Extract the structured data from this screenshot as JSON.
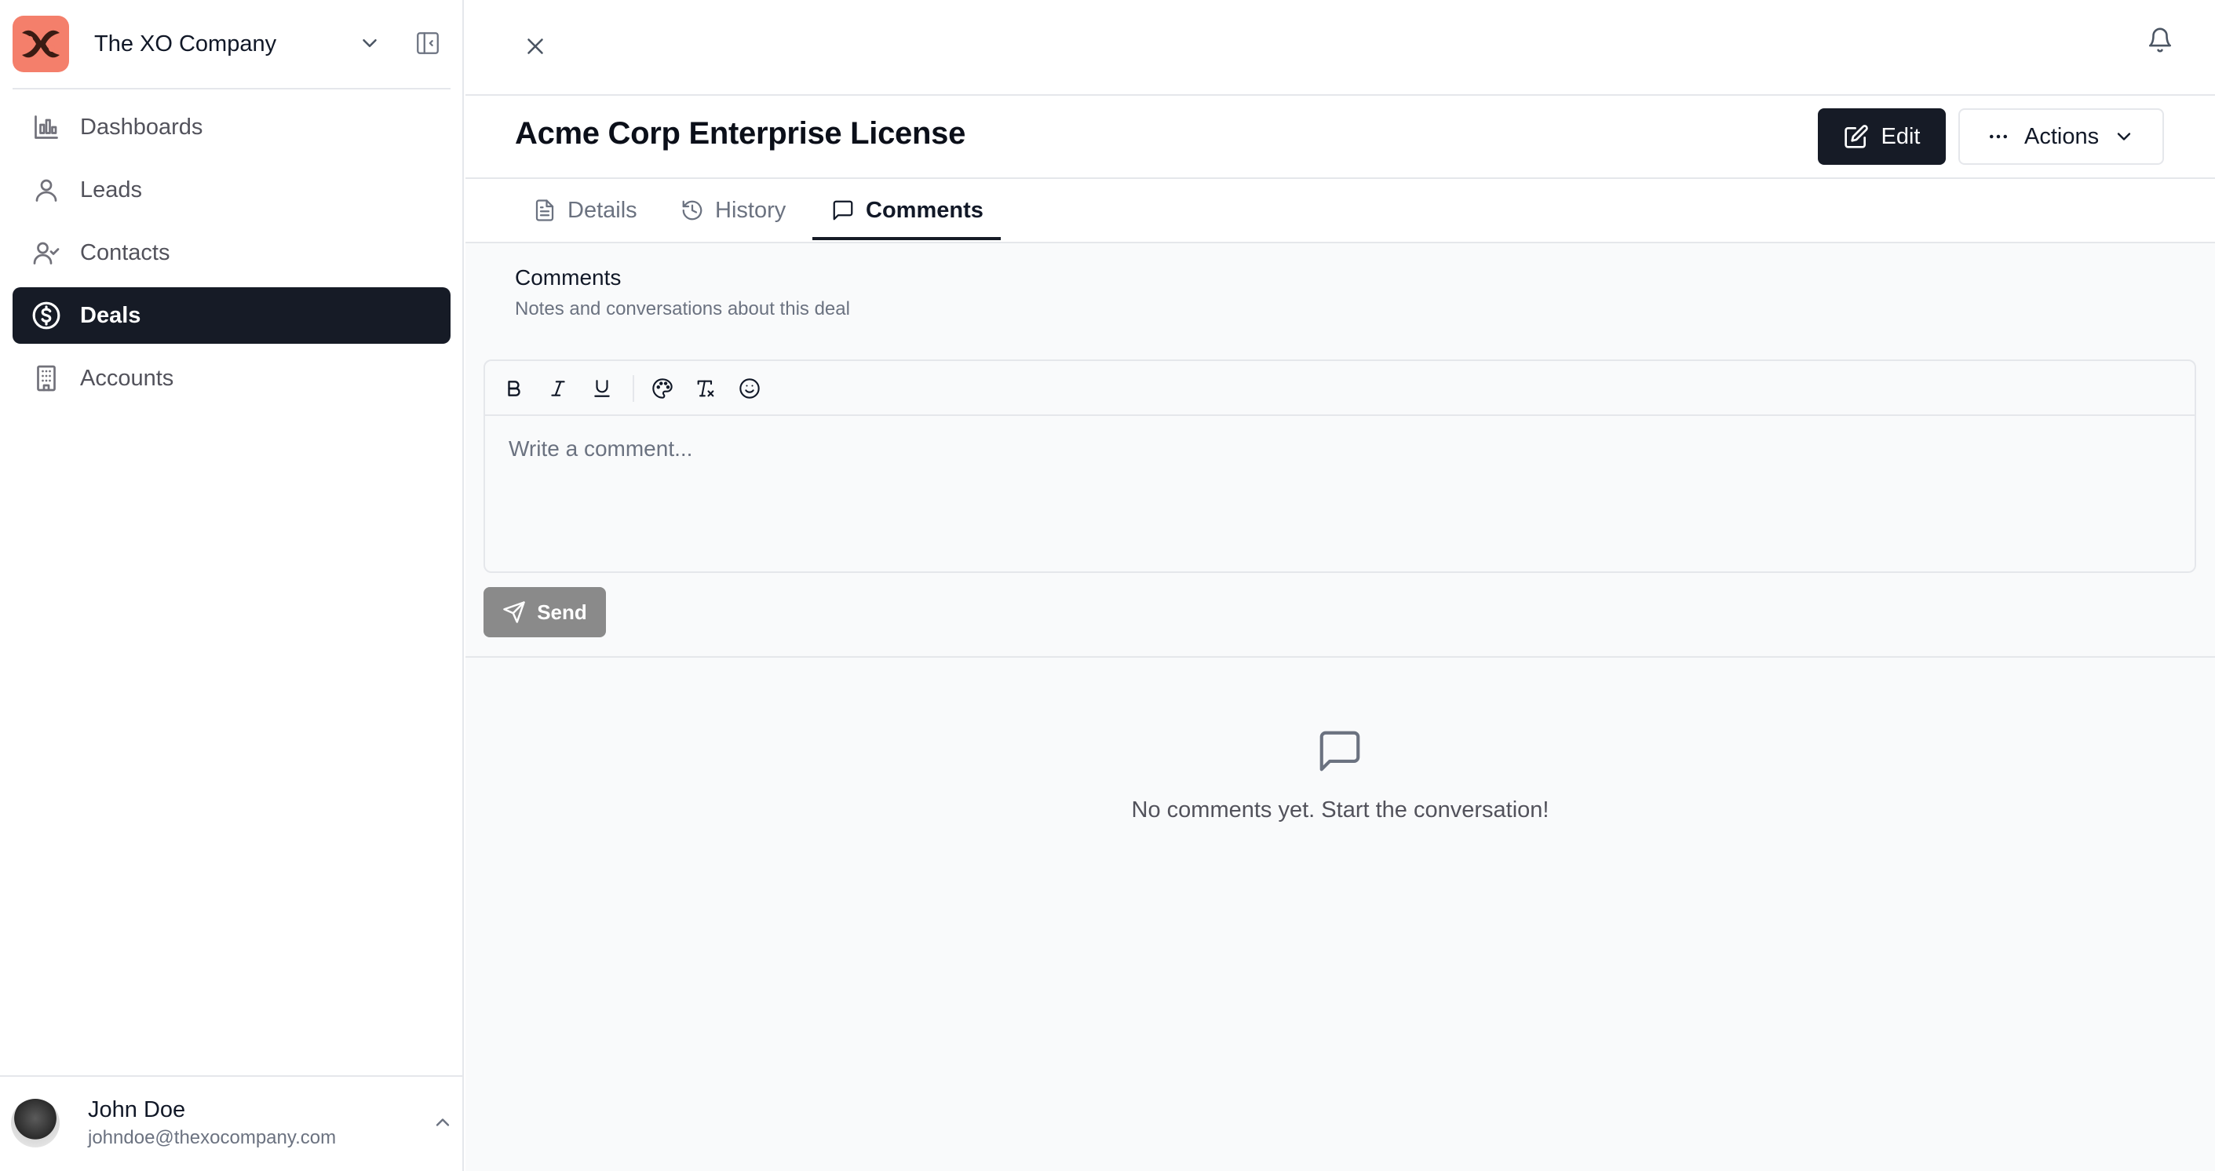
{
  "sidebar": {
    "company_name": "The XO Company",
    "nav": [
      {
        "label": "Dashboards",
        "icon": "bar-chart-icon",
        "active": false
      },
      {
        "label": "Leads",
        "icon": "user-icon",
        "active": false
      },
      {
        "label": "Contacts",
        "icon": "user-check-icon",
        "active": false
      },
      {
        "label": "Deals",
        "icon": "dollar-circle-icon",
        "active": true
      },
      {
        "label": "Accounts",
        "icon": "building-icon",
        "active": false
      }
    ],
    "user": {
      "name": "John Doe",
      "email": "johndoe@thexocompany.com"
    }
  },
  "header": {
    "title": "Acme Corp Enterprise License",
    "edit_label": "Edit",
    "actions_label": "Actions"
  },
  "tabs": [
    {
      "label": "Details",
      "icon": "file-text-icon",
      "active": false
    },
    {
      "label": "History",
      "icon": "history-icon",
      "active": false
    },
    {
      "label": "Comments",
      "icon": "message-square-icon",
      "active": true
    }
  ],
  "comments": {
    "title": "Comments",
    "subtitle": "Notes and conversations about this deal",
    "placeholder": "Write a comment...",
    "send_label": "Send",
    "toolbar": [
      "bold-icon",
      "italic-icon",
      "underline-icon",
      "palette-icon",
      "clear-format-icon",
      "emoji-icon"
    ],
    "empty_text": "No comments yet. Start the conversation!"
  },
  "colors": {
    "primary": "#161b26",
    "logo_bg": "#f47f6b",
    "send_disabled": "#8a8a8a",
    "content_bg": "#f9fafb"
  }
}
